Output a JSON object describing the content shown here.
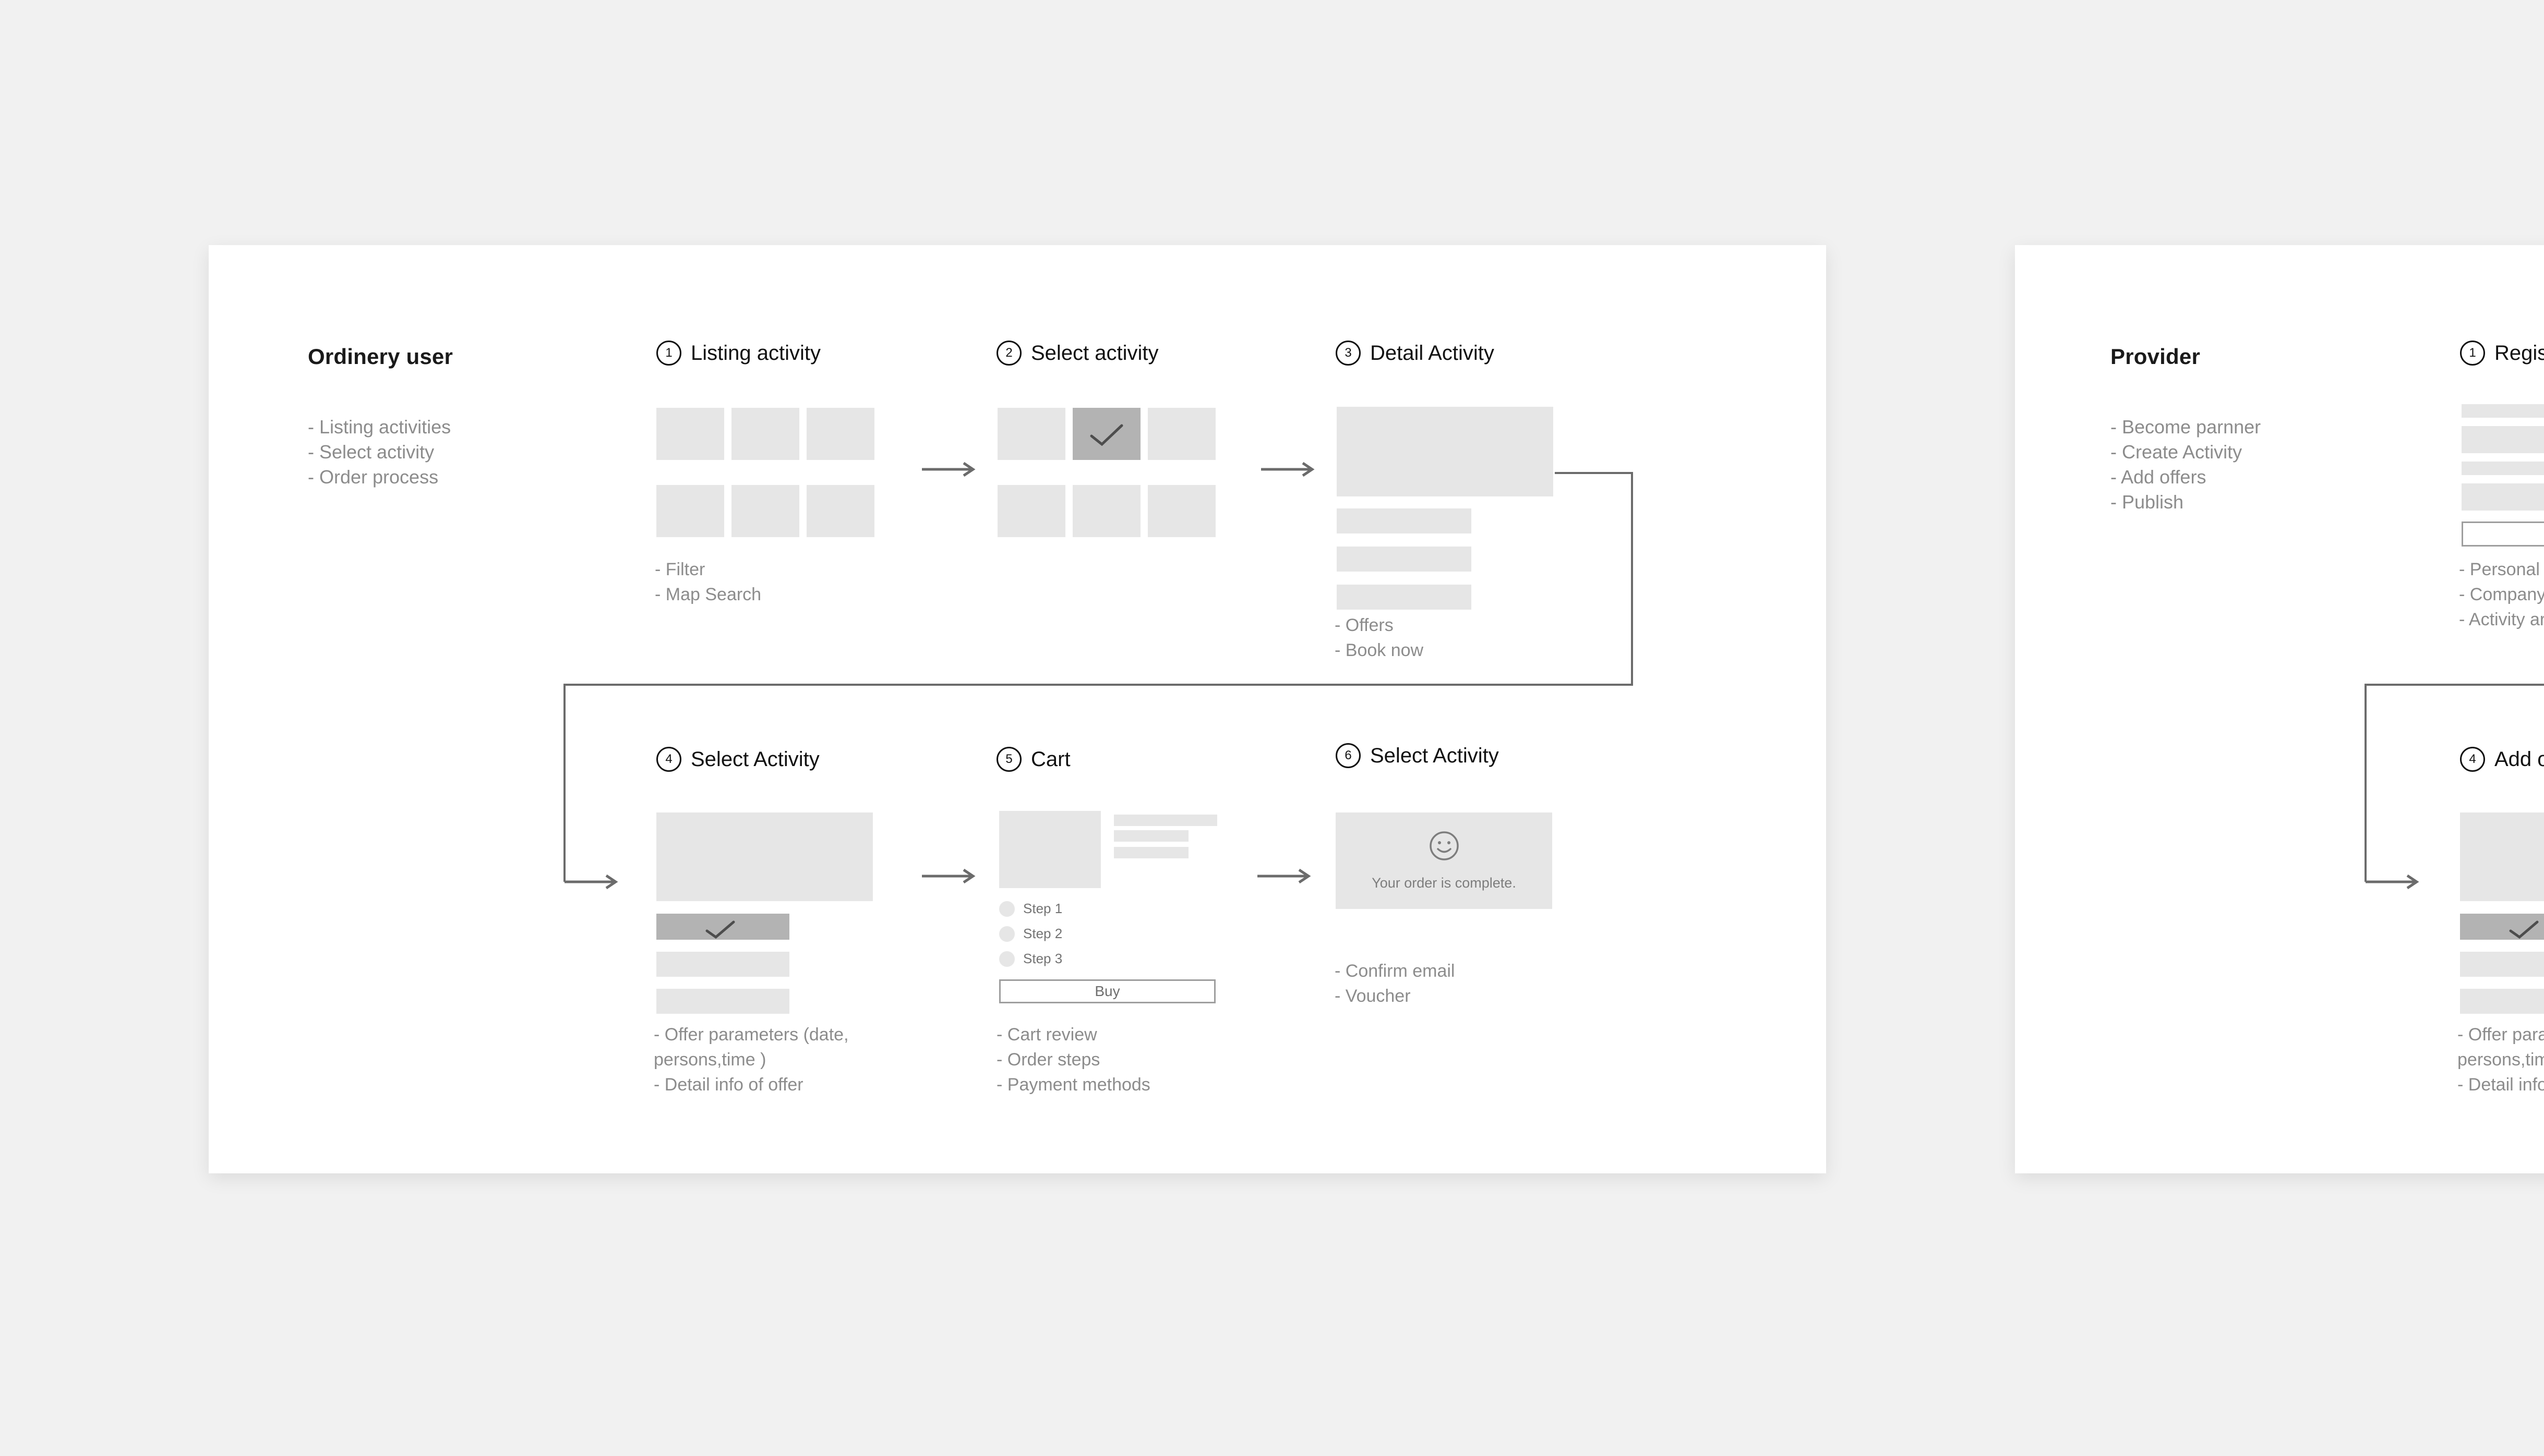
{
  "canvas": {
    "background": "#f1f1f1",
    "card_background": "#ffffff"
  },
  "palette": {
    "placeholder": "#e6e6e6",
    "placeholder_selected": "#b3b3b3",
    "text_muted": "#8c8c8c",
    "text_dark": "#111111",
    "line": "#6b6b6b"
  },
  "user_flow": {
    "persona": {
      "title": "Ordinery user",
      "items": [
        "- Listing activities",
        "- Select activity",
        "- Order process"
      ]
    },
    "steps": [
      {
        "number": "1",
        "label": "Listing activity",
        "annotations": [
          "- Filter",
          "- Map Search"
        ]
      },
      {
        "number": "2",
        "label": "Select activity",
        "annotations": []
      },
      {
        "number": "3",
        "label": "Detail Activity",
        "annotations": [
          "- Offers",
          "- Book now"
        ]
      },
      {
        "number": "4",
        "label": "Select Activity",
        "annotations": [
          "- Offer parameters (date, persons,time )",
          "- Detail info of offer"
        ]
      },
      {
        "number": "5",
        "label": "Cart",
        "annotations": [
          "- Cart review",
          "- Order steps",
          "- Payment methods"
        ],
        "cart_steps": [
          "Step 1",
          "Step 2",
          "Step 3"
        ],
        "buy_label": "Buy"
      },
      {
        "number": "6",
        "label": "Select Activity",
        "annotations": [
          "- Confirm email",
          "- Voucher"
        ],
        "complete_message": "Your order is complete."
      }
    ]
  },
  "provider_flow": {
    "persona": {
      "title": "Provider",
      "items": [
        "- Become parnner",
        "- Create Activity",
        "- Add offers",
        "- Publish"
      ]
    },
    "steps": [
      {
        "number": "1",
        "label": "Registration",
        "annotations": [
          "- Personal data",
          "- Company data",
          "- Activity area"
        ]
      },
      {
        "number": "4",
        "label": "Add offers",
        "annotations": [
          "- Offer parameters (date, persons,time )",
          "- Detail info of offer"
        ]
      }
    ]
  },
  "icons": {
    "check": "check-icon",
    "smiley": "smiley-face-icon",
    "arrow": "arrow-right-icon"
  }
}
